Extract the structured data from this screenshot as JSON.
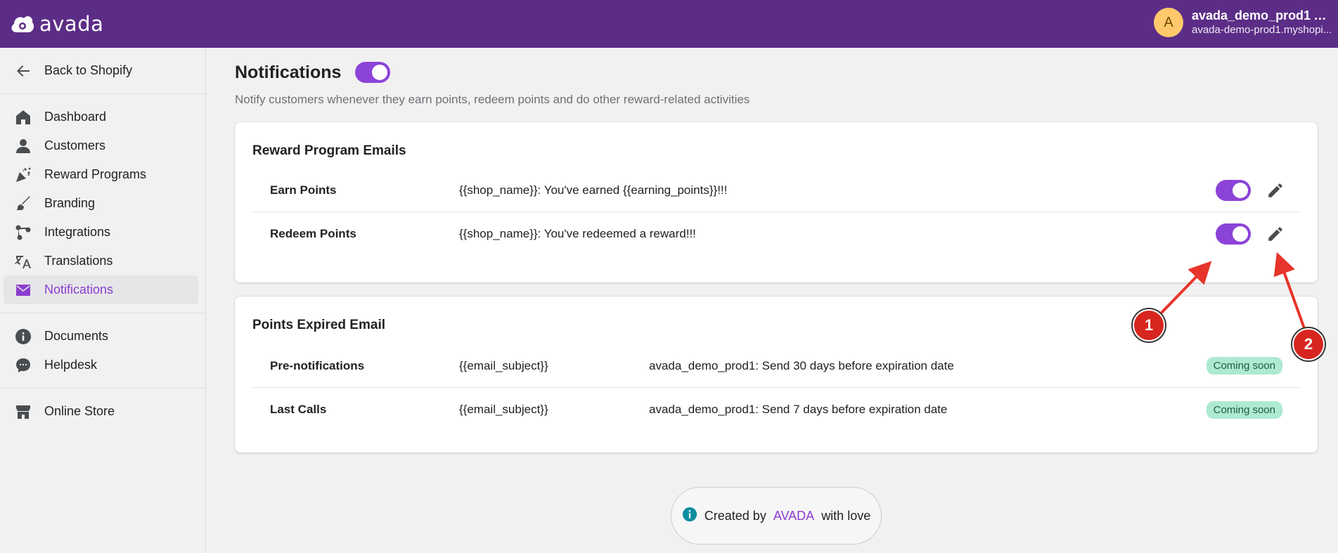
{
  "app": {
    "brand": "avada"
  },
  "account": {
    "initial": "A",
    "name": "avada_demo_prod1 Ad...",
    "url": "avada-demo-prod1.myshopi..."
  },
  "sidebar": {
    "back": "Back to Shopify",
    "items": [
      {
        "label": "Dashboard",
        "icon": "home-icon"
      },
      {
        "label": "Customers",
        "icon": "person-icon"
      },
      {
        "label": "Reward Programs",
        "icon": "confetti-icon"
      },
      {
        "label": "Branding",
        "icon": "brush-icon"
      },
      {
        "label": "Integrations",
        "icon": "integrations-icon"
      },
      {
        "label": "Translations",
        "icon": "translate-icon"
      },
      {
        "label": "Notifications",
        "icon": "mail-icon",
        "active": true
      }
    ],
    "items2": [
      {
        "label": "Documents",
        "icon": "info-icon"
      },
      {
        "label": "Helpdesk",
        "icon": "chat-icon"
      }
    ],
    "items3": [
      {
        "label": "Online Store",
        "icon": "store-icon"
      }
    ]
  },
  "page": {
    "title": "Notifications",
    "enabled": true,
    "description": "Notify customers whenever they earn points, redeem points and do other reward-related activities"
  },
  "reward_emails": {
    "title": "Reward Program Emails",
    "rows": [
      {
        "name": "Earn Points",
        "subject": "{{shop_name}}: You've earned {{earning_points}}!!!",
        "enabled": true
      },
      {
        "name": "Redeem Points",
        "subject": "{{shop_name}}: You've redeemed a reward!!!",
        "enabled": true
      }
    ]
  },
  "expired_emails": {
    "title": "Points Expired Email",
    "rows": [
      {
        "name": "Pre-notifications",
        "subject": "{{email_subject}}",
        "desc": "avada_demo_prod1: Send 30 days before expiration date",
        "badge": "Coming soon"
      },
      {
        "name": "Last Calls",
        "subject": "{{email_subject}}",
        "desc": "avada_demo_prod1: Send 7 days before expiration date",
        "badge": "Coming soon"
      }
    ]
  },
  "footer": {
    "prefix": "Created by",
    "brand": "AVADA",
    "suffix": "with love"
  },
  "annotations": {
    "marker1": "1",
    "marker2": "2"
  },
  "colors": {
    "header": "#5c2d87",
    "accent": "#8c43d8",
    "badge": "#aee9d1",
    "marker": "#d7261f"
  }
}
